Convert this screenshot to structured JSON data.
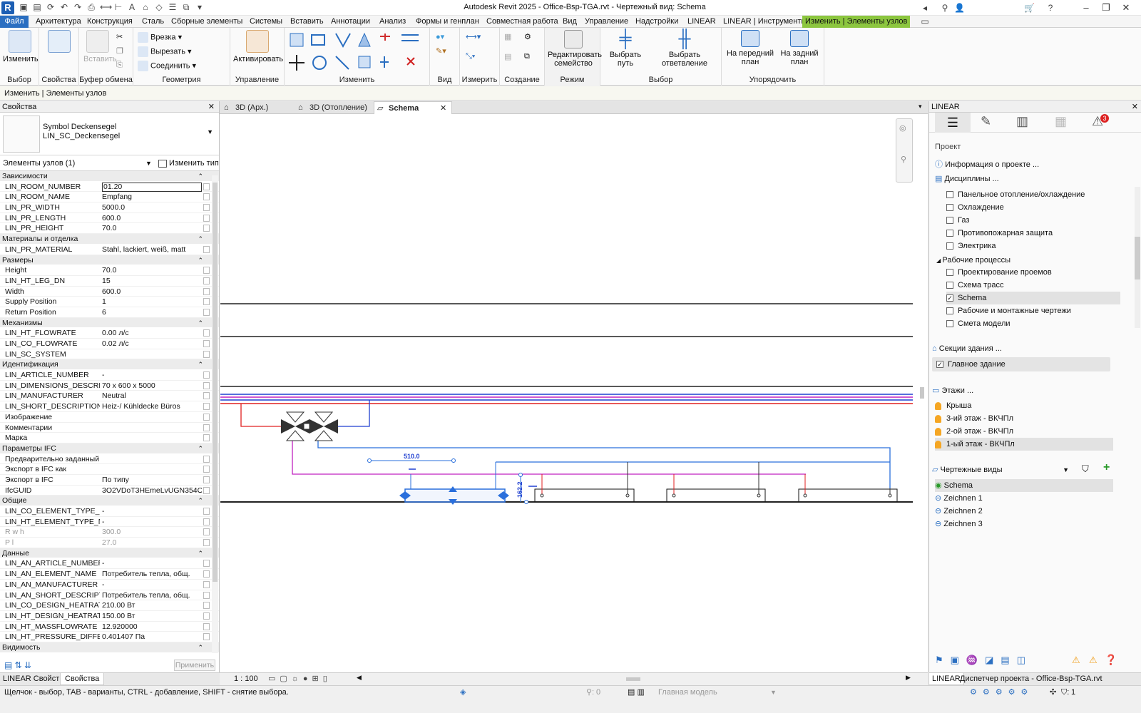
{
  "title_bar": {
    "title": "Autodesk Revit 2025 - Office-Bsp-TGA.rvt - Чертежный вид: Schema"
  },
  "ribbon_tabs": [
    "Файл",
    "Архитектура",
    "Конструкция",
    "Сталь",
    "Сборные элементы",
    "Системы",
    "Вставить",
    "Аннотации",
    "Анализ",
    "Формы и генплан",
    "Совместная работа",
    "Вид",
    "Управление",
    "Надстройки",
    "LINEAR",
    "LINEAR | Инструменты",
    "Изменить | Элементы узлов"
  ],
  "ribbon": {
    "select": {
      "modify_label": "Изменить",
      "panel_label": "Выбор"
    },
    "properties": {
      "panel_label": "Свойства"
    },
    "clipboard": {
      "paste_label": "Вставить",
      "panel_label": "Буфер обмена"
    },
    "geometry": {
      "cut_label": "Врезка",
      "cut2_label": "Вырезать",
      "join_label": "Соединить",
      "panel_label": "Геометрия"
    },
    "control": {
      "activate_label": "Активировать",
      "panel_label": "Управление"
    },
    "modify": {
      "panel_label": "Изменить"
    },
    "view": {
      "panel_label": "Вид"
    },
    "measure": {
      "panel_label": "Измерить"
    },
    "create": {
      "panel_label": "Создание"
    },
    "mode": {
      "edit_family_label": "Редактировать семейство",
      "panel_label": "Режим"
    },
    "selection": {
      "select_path_label": "Выбрать путь",
      "select_branch_label": "Выбрать ответвление",
      "panel_label": "Выбор"
    },
    "arrange": {
      "front_label": "На передний план",
      "back_label": "На задний план",
      "panel_label": "Упорядочить"
    }
  },
  "context_bar": "Изменить | Элементы узлов",
  "properties_panel": {
    "header": "Свойства",
    "type_name_1": "Symbol Deckensegel",
    "type_name_2": "LIN_SC_Deckensegel",
    "instance_filter": "Элементы узлов (1)",
    "edit_type_label": "Изменить тип",
    "apply_label": "Применить",
    "groups": [
      {
        "name": "Зависимости",
        "rows": [
          [
            "LIN_ROOM_NUMBER",
            "01.20"
          ],
          [
            "LIN_ROOM_NAME",
            "Empfang"
          ],
          [
            "LIN_PR_WIDTH",
            "5000.0"
          ],
          [
            "LIN_PR_LENGTH",
            "600.0"
          ],
          [
            "LIN_PR_HEIGHT",
            "70.0"
          ]
        ]
      },
      {
        "name": "Материалы и отделка",
        "rows": [
          [
            "LIN_PR_MATERIAL",
            "Stahl, lackiert, weiß, matt"
          ]
        ]
      },
      {
        "name": "Размеры",
        "rows": [
          [
            "Height",
            "70.0"
          ],
          [
            "LIN_HT_LEG_DN",
            "15"
          ],
          [
            "Width",
            "600.0"
          ],
          [
            "Supply Position",
            "1"
          ],
          [
            "Return Position",
            "6"
          ]
        ]
      },
      {
        "name": "Механизмы",
        "rows": [
          [
            "LIN_HT_FLOWRATE",
            "0.00 л/с"
          ],
          [
            "LIN_CO_FLOWRATE",
            "0.02 л/с"
          ],
          [
            "LIN_SC_SYSTEM",
            ""
          ]
        ]
      },
      {
        "name": "Идентификация",
        "rows": [
          [
            "LIN_ARTICLE_NUMBER",
            "-"
          ],
          [
            "LIN_DIMENSIONS_DESCRIPTI...",
            "70 x 600 x 5000"
          ],
          [
            "LIN_MANUFACTURER",
            "Neutral"
          ],
          [
            "LIN_SHORT_DESCRIPTION",
            "Heiz-/ Kühldecke Büros"
          ],
          [
            "Изображение",
            ""
          ],
          [
            "Комментарии",
            ""
          ],
          [
            "Марка",
            ""
          ]
        ]
      },
      {
        "name": "Параметры IFC",
        "rows": [
          [
            "Предварительно заданный ...",
            ""
          ],
          [
            "Экспорт в IFC как",
            ""
          ],
          [
            "Экспорт в IFC",
            "По типу"
          ],
          [
            "IfcGUID",
            "3O2VDoT3HEmeLvUGN354Ov"
          ]
        ]
      },
      {
        "name": "Общие",
        "rows": [
          [
            "LIN_CO_ELEMENT_TYPE_NA...",
            "-"
          ],
          [
            "LIN_HT_ELEMENT_TYPE_NA...",
            "-"
          ],
          [
            "R w h",
            "300.0"
          ],
          [
            "P l",
            "27.0"
          ]
        ]
      },
      {
        "name": "Данные",
        "rows": [
          [
            "LIN_AN_ARTICLE_NUMBER",
            "-"
          ],
          [
            "LIN_AN_ELEMENT_NAME",
            "Потребитель тепла, общ."
          ],
          [
            "LIN_AN_MANUFACTURER",
            "-"
          ],
          [
            "LIN_AN_SHORT_DESCRIPTION",
            "Потребитель тепла, общ."
          ],
          [
            "LIN_CO_DESIGN_HEATRATE",
            "210.00 Вт"
          ],
          [
            "LIN_HT_DESIGN_HEATRATE",
            "150.00 Вт"
          ],
          [
            "LIN_HT_MASSFLOWRATE",
            "12.920000"
          ],
          [
            "LIN_HT_PRESSURE_DIFFEREN...",
            "0.401407 Па"
          ]
        ]
      },
      {
        "name": "Видимость",
        "rows": []
      }
    ],
    "bottom_tabs": [
      "LINEAR Свойства",
      "Свойства"
    ]
  },
  "view_tabs": [
    {
      "label": "3D (Арх.)"
    },
    {
      "label": "3D (Отопление)"
    },
    {
      "label": "Schema"
    }
  ],
  "canvas": {
    "dim_horizontal": "510.0",
    "dim_vertical": "162.2"
  },
  "view_bar": {
    "scale": "1 : 100"
  },
  "linear_panel": {
    "header": "LINEAR",
    "project_label": "Проект",
    "project_info": "Информация о проекте ...",
    "disciplines_label": "Дисциплины ...",
    "disciplines": [
      "Панельное отопление/охлаждение",
      "Охлаждение",
      "Газ",
      "Противопожарная защита",
      "Электрика"
    ],
    "workflows_label": "Рабочие процессы",
    "workflows": [
      {
        "label": "Проектирование проемов",
        "checked": false
      },
      {
        "label": "Схема трасс",
        "checked": false
      },
      {
        "label": "Schema",
        "checked": true
      },
      {
        "label": "Рабочие и монтажные чертежи",
        "checked": false
      },
      {
        "label": "Смета модели",
        "checked": false
      }
    ],
    "building_sections_label": "Секции здания ...",
    "main_building": "Главное здание",
    "floors_label": "Этажи ...",
    "floors": [
      "Крыша",
      "3-ий этаж - ВКЧПл",
      "2-ой этаж - ВКЧПл",
      "1-ый этаж - ВКЧПл"
    ],
    "drawing_views_label": "Чертежные виды",
    "drawing_views": [
      "Schema",
      "Zeichnen 1",
      "Zeichnen 2",
      "Zeichnen 3"
    ],
    "warning_count": "3",
    "bottom_tabs": [
      "LINEAR",
      "Диспетчер проекта - Office-Bsp-TGA.rvt"
    ]
  },
  "status_bar": {
    "hint": "Щелчок - выбор, TAB - варианты, CTRL - добавление, SHIFT - снятие выбора.",
    "selection_count": "0",
    "model": "Главная модель",
    "filter_count": "1"
  },
  "colors": {
    "accent": "#2b6fc1",
    "context_tab": "#8cc63f",
    "supply": "#e02020",
    "return": "#1f3fd0",
    "secondary": "#c020c0",
    "selected": "#2a6fdc"
  }
}
